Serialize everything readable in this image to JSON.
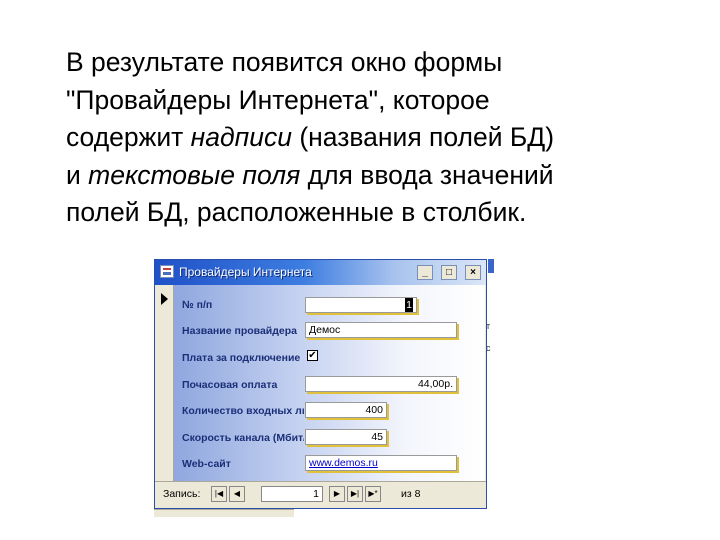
{
  "slide": {
    "line1": "В результате появится окно формы",
    "line2": "\"Провайдеры Интернета\", которое",
    "line3_a": "содержит ",
    "line3_b": "надписи",
    "line3_c": " (названия полей БД)",
    "line4_a": "и ",
    "line4_b": "текстовые поля",
    "line4_c": " для ввода значений",
    "line5": "полей БД, расположенные в столбик."
  },
  "window": {
    "title": "Провайдеры Интернета",
    "icon": "form-icon",
    "controls": {
      "minimize": "_",
      "maximize": "□",
      "close": "×"
    }
  },
  "form": {
    "fields": [
      {
        "label": "№ п/п",
        "value": "1"
      },
      {
        "label": "Название провайдера",
        "value": "Демос"
      },
      {
        "label": "Плата за подключение",
        "value": "✔"
      },
      {
        "label": "Почасовая оплата",
        "value": "44,00р."
      },
      {
        "label": "Количество входных линий",
        "value": "400"
      },
      {
        "label": "Скорость канала (Мбит/с)",
        "value": "45"
      },
      {
        "label": "Web-сайт",
        "value": "www.demos.ru"
      }
    ]
  },
  "navigation": {
    "record_label": "Запись:",
    "current_record": "1",
    "of_label": "из",
    "total_records": "8",
    "buttons": {
      "first": "|◀",
      "prev": "◀",
      "next": "▶",
      "last": "▶|",
      "new": "▶*"
    }
  },
  "background_fragments": [
    "т",
    "с"
  ],
  "colors": {
    "title_bar": "#1f51c8",
    "label_text": "#1b2f78",
    "field_shadow": "#e1c13a",
    "window_bg": "#ece9d8"
  }
}
